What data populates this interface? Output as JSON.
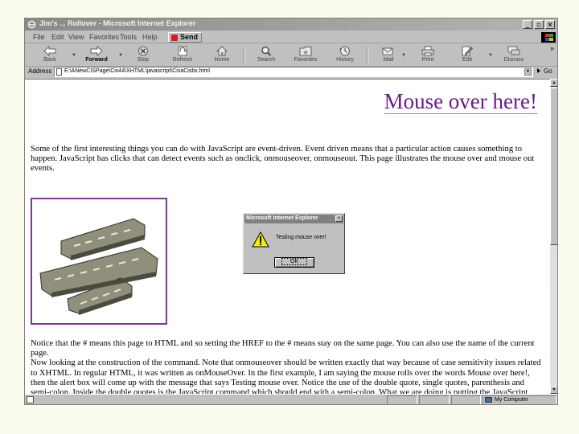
{
  "window": {
    "title": "Jim's ... Rollover - Microsoft Internet Explorer",
    "controls": [
      "_",
      "▫",
      "×"
    ]
  },
  "menu": {
    "items": [
      "File",
      "Edit",
      "View",
      "Favorites",
      "Tools",
      "Help"
    ],
    "send_label": "Send"
  },
  "toolbar": {
    "buttons": [
      "Back",
      "Forward",
      "Stop",
      "Refresh",
      "Home",
      "Search",
      "Favorites",
      "History",
      "Mail",
      "Print",
      "Edit",
      "Discuss"
    ],
    "more": "»"
  },
  "address": {
    "label": "Address",
    "url": "E:\\ANewCISPage\\Cis44\\XHTML\\javascript\\CisaCisbx.html",
    "go_label": "Go"
  },
  "page": {
    "heading": "Mouse over here!",
    "paragraph1": "Some of the first interesting things you can do with JavaScript are event-driven. Event driven means that a particular action causes something to happen. JavaScript has clicks that can detect events such as onclick, onmouseover, onmouseout. This page illustrates the mouse over and mouse out events.",
    "paragraph2": "Notice that the # means this page to HTML and so setting the HREF to the # means stay on the same page. You can also use the name of the current page.",
    "paragraph3": "Now looking at the construction of the command. Note that onmouseover should be written exactly that way because of case sensitivity issues related to XHTML. In regular HTML, it was written as onMouseOver. In the first example, I am saying the mouse rolls over the words Mouse over here!, then the alert box will come up with the message that says Testing mouse over. Notice the use of the double quote, single quotes, parenthesis and semi-colon. Inside the double quotes is the JavaScript command which should end with a semi-colon. What we are doing is putting the JavaScript inside the quotes of an event. The event is onmouseover."
  },
  "dialog": {
    "title": "Microsoft Internet Explorer",
    "message": "Testing mouse over!",
    "ok_label": "OK",
    "close": "×"
  },
  "scrollbar": {
    "up": "▲",
    "down": "▼"
  },
  "status": {
    "zone": "My Computer"
  }
}
